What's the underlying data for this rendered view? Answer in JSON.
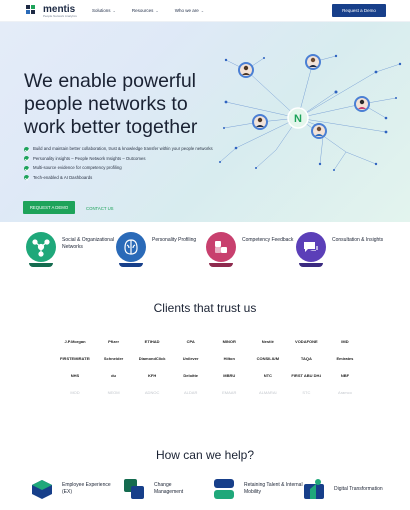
{
  "header": {
    "brand": "mentis",
    "brand_sub": "People Network Analytics",
    "nav": [
      {
        "label": "Solutions"
      },
      {
        "label": "Resources"
      },
      {
        "label": "Who we are"
      }
    ],
    "nav_chevron": "⌄",
    "cta": "Request a Demo"
  },
  "hero": {
    "title": "We enable powerful people networks to work better together",
    "bullets": [
      "Build and maintain better collaboration, trust & knowledge transfer within your people networks",
      "Personality insights – People Network Insights – Outcomes",
      "Multi-source evidence for competency profiling",
      "Tech-enabled & AI Dashboards"
    ],
    "primary_cta": "REQUEST A DEMO",
    "secondary_cta": "CONTACT US",
    "center_badge": "N"
  },
  "features": [
    {
      "label": "Social & Organizational Networks",
      "icon": "network-icon",
      "color": "#1fa87a",
      "bar": "#146b4f"
    },
    {
      "label": "Personality Profiling",
      "icon": "brain-icon",
      "color": "#2a6ab8",
      "bar": "#173f8a"
    },
    {
      "label": "Competency Feedback",
      "icon": "feedback-icon",
      "color": "#c8406e",
      "bar": "#8e2a4e"
    },
    {
      "label": "Consultation & Insights",
      "icon": "chat-icon",
      "color": "#5b3fb8",
      "bar": "#3a2a80"
    }
  ],
  "clients_title": "Clients that trust us",
  "clients": [
    [
      "J.P.Morgan",
      "Pfizer",
      "ETIHAD",
      "CPA",
      "MINOR",
      "Nestlé",
      "VODAFONE",
      "IMD"
    ],
    [
      "FIRSTEMIRATES",
      "Schneider",
      "DiamondClick",
      "Unilever",
      "Hilton",
      "CONSILIUM",
      "TAQA",
      "Emirates"
    ],
    [
      "NHS",
      "du",
      "KFH",
      "Deloitte",
      "MBRU",
      "NTC",
      "FIRST ABU DHABI",
      "NBF"
    ],
    [
      "MOD",
      "NEOM",
      "ADNOC",
      "ALDAR",
      "EMAAR",
      "ALMARAI",
      "STC",
      "Aramco"
    ]
  ],
  "help_title": "How can we help?",
  "help": [
    {
      "label": "Employee Experience (EX)",
      "icon": "employee-experience-icon"
    },
    {
      "label": "Change Management",
      "icon": "change-management-icon"
    },
    {
      "label": "Retaining Talent & Internal Mobility",
      "icon": "talent-icon"
    },
    {
      "label": "Digital Transformation",
      "icon": "digital-transformation-icon"
    }
  ],
  "colors": {
    "brand_navy": "#173f8a",
    "accent_green": "#1ea35a",
    "text": "#1a2233"
  }
}
